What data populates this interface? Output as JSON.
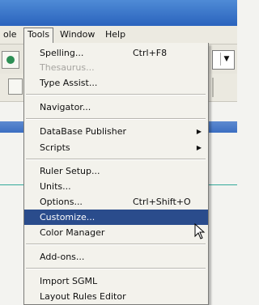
{
  "menubar": {
    "items": [
      "ole",
      "Tools",
      "Window",
      "Help"
    ]
  },
  "tools_menu": {
    "items": [
      {
        "label": "Spelling...",
        "shortcut": "Ctrl+F8"
      },
      {
        "label": "Thesaurus...",
        "disabled": true
      },
      {
        "label": "Type Assist..."
      },
      {
        "label": "Navigator..."
      },
      {
        "label": "DataBase Publisher",
        "submenu": true
      },
      {
        "label": "Scripts",
        "submenu": true
      },
      {
        "label": "Ruler Setup..."
      },
      {
        "label": "Units..."
      },
      {
        "label": "Options...",
        "shortcut": "Ctrl+Shift+O"
      },
      {
        "label": "Customize...",
        "highlighted": true
      },
      {
        "label": "Color Manager"
      },
      {
        "label": "Add-ons..."
      },
      {
        "label": "Import SGML"
      },
      {
        "label": "Layout Rules Editor"
      }
    ],
    "submenu_glyph": "▶"
  },
  "colors": {
    "highlight": "#2a4c8c",
    "titlebar": "#2a63bd",
    "menu_bg": "#f3f2ec"
  },
  "icons": [
    "mouse-pointer-icon",
    "dropdown-arrow-icon",
    "submenu-arrow-icon"
  ]
}
